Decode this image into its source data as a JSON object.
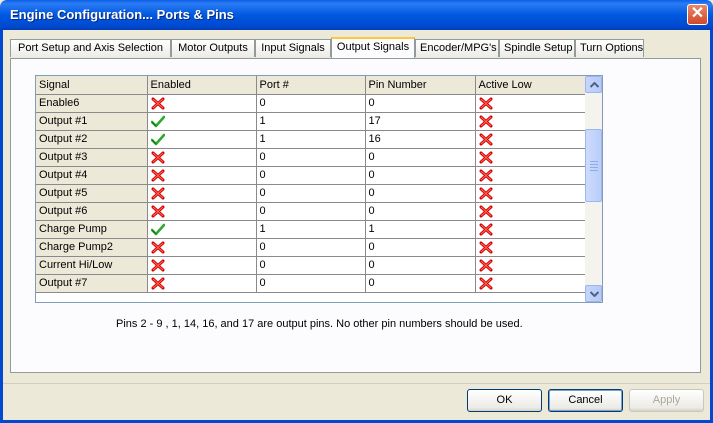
{
  "window": {
    "title": "Engine Configuration... Ports & Pins",
    "close_glyph": "✕"
  },
  "tabs": [
    {
      "label": "Port Setup and Axis Selection"
    },
    {
      "label": "Motor Outputs"
    },
    {
      "label": "Input Signals"
    },
    {
      "label": "Output Signals",
      "active": true
    },
    {
      "label": "Encoder/MPG's"
    },
    {
      "label": "Spindle Setup"
    },
    {
      "label": "Turn Options"
    }
  ],
  "grid": {
    "columns": [
      "Signal",
      "Enabled",
      "Port #",
      "Pin Number",
      "Active Low"
    ],
    "rows": [
      {
        "signal": "Enable6",
        "enabled": false,
        "port": "0",
        "pin": "0",
        "active_low": false
      },
      {
        "signal": "Output #1",
        "enabled": true,
        "port": "1",
        "pin": "17",
        "active_low": false
      },
      {
        "signal": "Output #2",
        "enabled": true,
        "port": "1",
        "pin": "16",
        "active_low": false
      },
      {
        "signal": "Output #3",
        "enabled": false,
        "port": "0",
        "pin": "0",
        "active_low": false
      },
      {
        "signal": "Output #4",
        "enabled": false,
        "port": "0",
        "pin": "0",
        "active_low": false
      },
      {
        "signal": "Output #5",
        "enabled": false,
        "port": "0",
        "pin": "0",
        "active_low": false
      },
      {
        "signal": "Output #6",
        "enabled": false,
        "port": "0",
        "pin": "0",
        "active_low": false
      },
      {
        "signal": "Charge Pump",
        "enabled": true,
        "port": "1",
        "pin": "1",
        "active_low": false
      },
      {
        "signal": "Charge Pump2",
        "enabled": false,
        "port": "0",
        "pin": "0",
        "active_low": false
      },
      {
        "signal": "Current Hi/Low",
        "enabled": false,
        "port": "0",
        "pin": "0",
        "active_low": false
      },
      {
        "signal": "Output #7",
        "enabled": false,
        "port": "0",
        "pin": "0",
        "active_low": false
      }
    ]
  },
  "note": "Pins 2 - 9 , 1, 14, 16, and 17 are output pins.  No  other pin numbers should be used.",
  "buttons": {
    "ok": "OK",
    "cancel": "Cancel",
    "apply": "Apply"
  },
  "colors": {
    "check": "#2fa82f",
    "cross": "#d40000",
    "title_bar": "#0058e0",
    "tab_highlight": "#ffc83c"
  }
}
